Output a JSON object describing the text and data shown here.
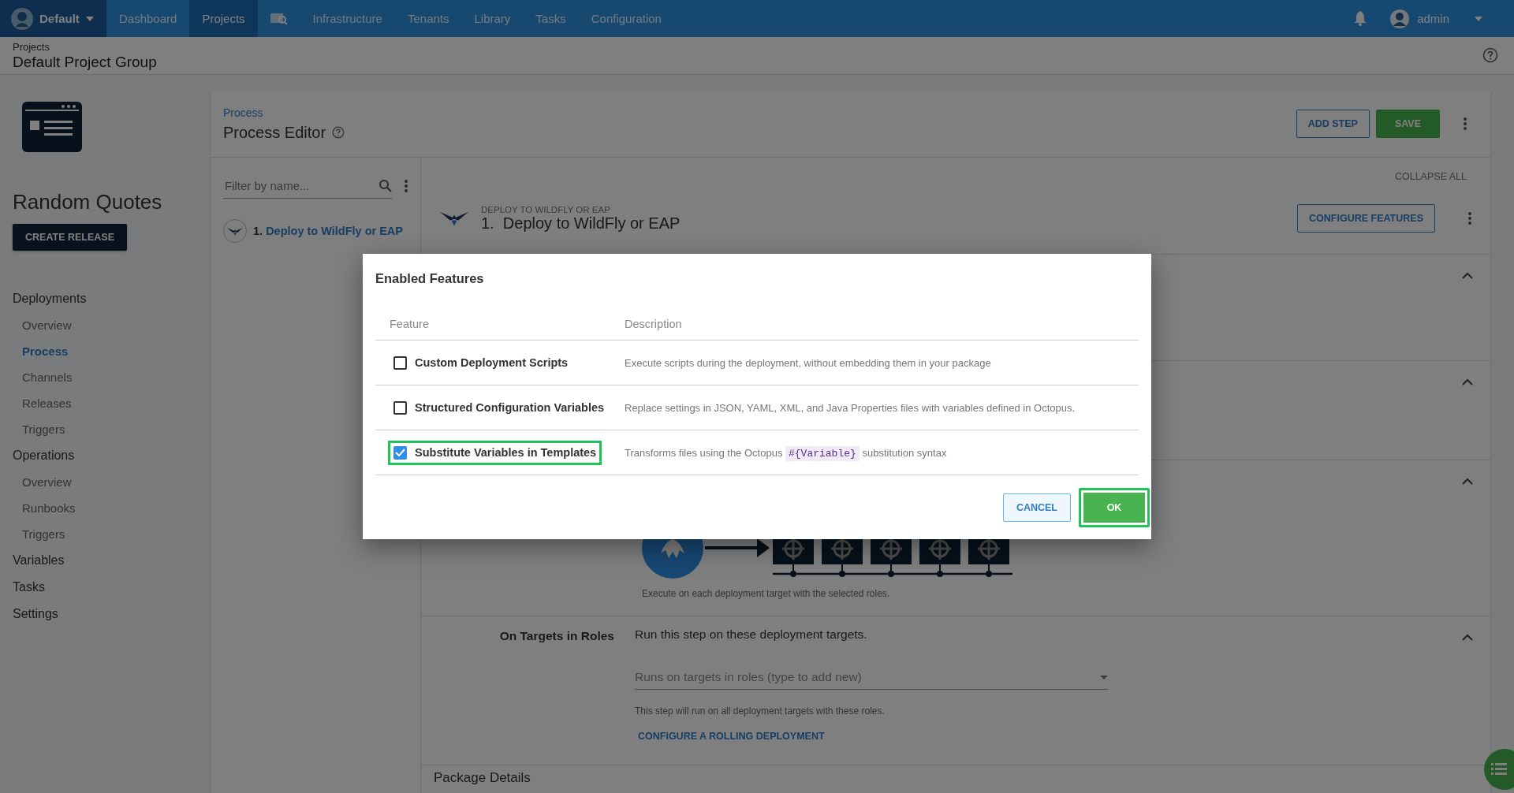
{
  "top_nav": {
    "org": "Default",
    "items": [
      {
        "kind": "text",
        "label": "Dashboard",
        "selected": false
      },
      {
        "kind": "text",
        "label": "Projects",
        "selected": true
      },
      {
        "kind": "icon",
        "selected": false
      },
      {
        "kind": "text",
        "label": "Infrastructure",
        "selected": false
      },
      {
        "kind": "text",
        "label": "Tenants",
        "selected": false
      },
      {
        "kind": "text",
        "label": "Library",
        "selected": false
      },
      {
        "kind": "text",
        "label": "Tasks",
        "selected": false
      },
      {
        "kind": "text",
        "label": "Configuration",
        "selected": false
      }
    ],
    "user": "admin"
  },
  "breadcrumb": {
    "parent": "Projects",
    "title": "Default Project Group"
  },
  "project": {
    "name": "Random Quotes",
    "create_release": "CREATE RELEASE"
  },
  "sidebar": {
    "groups": [
      {
        "label": "Deployments",
        "selected": false,
        "children": [
          {
            "label": "Overview",
            "selected": false
          },
          {
            "label": "Process",
            "selected": true
          },
          {
            "label": "Channels",
            "selected": false
          },
          {
            "label": "Releases",
            "selected": false
          },
          {
            "label": "Triggers",
            "selected": false
          }
        ]
      },
      {
        "label": "Operations",
        "selected": false,
        "children": [
          {
            "label": "Overview",
            "selected": false
          },
          {
            "label": "Runbooks",
            "selected": false
          },
          {
            "label": "Triggers",
            "selected": false
          }
        ]
      },
      {
        "label": "Variables",
        "selected": false
      },
      {
        "label": "Tasks",
        "selected": false
      },
      {
        "label": "Settings",
        "selected": false
      }
    ]
  },
  "process": {
    "breadcrumb": "Process",
    "title": "Process Editor",
    "add_step": "ADD STEP",
    "save": "SAVE"
  },
  "steps_list": {
    "filter_placeholder": "Filter by name...",
    "steps": [
      {
        "number": "1.",
        "name": "Deploy to WildFly or EAP"
      }
    ]
  },
  "step": {
    "collapse_all": "COLLAPSE ALL",
    "type": "DEPLOY TO WILDFLY OR EAP",
    "number": "1.",
    "title": "Deploy to WildFly or EAP",
    "configure": "CONFIGURE FEATURES",
    "diagram_caption": "Execute on each deployment target with the selected roles.",
    "roles": {
      "label": "On Targets in Roles",
      "summary": "Run this step on these deployment targets.",
      "placeholder": "Runs on targets in roles (type to add new)",
      "hint": "This step will run on all deployment targets with these roles.",
      "link": "CONFIGURE A ROLLING DEPLOYMENT"
    },
    "next_section": "Package Details"
  },
  "dialog": {
    "title": "Enabled Features",
    "columns": [
      "Feature",
      "Description"
    ],
    "features": [
      {
        "name": "Custom Deployment Scripts",
        "checked": false,
        "highlighted": false,
        "description": "Execute scripts during the deployment, without embedding them in your package"
      },
      {
        "name": "Structured Configuration Variables",
        "checked": false,
        "highlighted": false,
        "description": "Replace settings in JSON, YAML, XML, and Java Properties files with variables defined in Octopus."
      },
      {
        "name": "Substitute Variables in Templates",
        "checked": true,
        "highlighted": true,
        "description": "Transforms files using the Octopus",
        "code": "#{Variable}",
        "description_after": "substitution syntax"
      }
    ],
    "buttons": [
      {
        "kind": "secondary",
        "label": "CANCEL",
        "highlighted": false
      },
      {
        "kind": "primary",
        "label": "OK",
        "highlighted": true
      }
    ]
  }
}
